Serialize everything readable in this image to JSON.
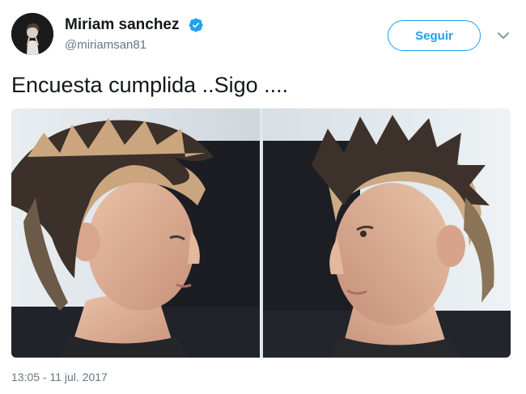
{
  "user": {
    "display_name": "Miriam sanchez",
    "handle": "@miriamsan81",
    "verified": true,
    "avatar_icon": "profile-photo"
  },
  "actions": {
    "follow_label": "Seguir",
    "menu_icon": "chevron-down-icon"
  },
  "tweet": {
    "text": "Encuesta cumplida ..Sigo ....",
    "timestamp": "13:05 - 11 jul. 2017",
    "media": [
      {
        "kind": "photo",
        "subject": "woman-profile-facing-right"
      },
      {
        "kind": "photo",
        "subject": "woman-profile-facing-left"
      }
    ]
  },
  "colors": {
    "accent": "#1da1f2",
    "text": "#14171a",
    "secondary_text": "#657786"
  }
}
